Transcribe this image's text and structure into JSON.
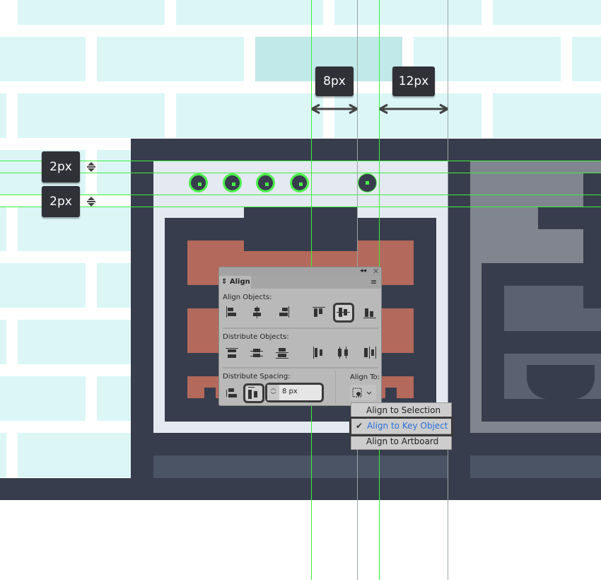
{
  "measurements": {
    "horizontal_gap": "8px",
    "horizontal_gap_2": "12px",
    "vertical_gap_1": "2px",
    "vertical_gap_2": "2px"
  },
  "align_panel": {
    "title": "Align",
    "align_objects_label": "Align Objects:",
    "distribute_objects_label": "Distribute Objects:",
    "distribute_spacing_label": "Distribute Spacing:",
    "align_to_label": "Align To:",
    "spacing_value": "8 px",
    "active_align": "vertical-align-center",
    "active_distribute": "horizontal-distribute-space"
  },
  "align_to_menu": {
    "items": [
      "Align to Selection",
      "Align to Key Object",
      "Align to Artboard"
    ],
    "selected": "Align to Key Object",
    "selected_color": "#2a6fd6"
  },
  "colors": {
    "background_brick": "#dcf6f6",
    "dark": "#373d4c",
    "light": "#e4e9f2",
    "salmon": "#b3695b",
    "guide": "#3cf03c"
  }
}
